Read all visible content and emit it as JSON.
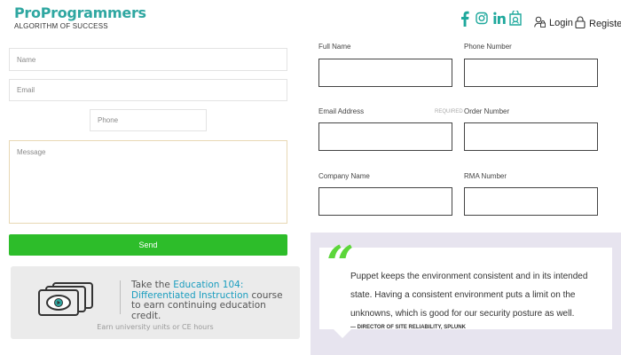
{
  "header": {
    "brand_name": "ProProgrammers",
    "brand_tagline": "ALGORITHM OF SUCCESS",
    "social_icons": [
      "facebook-icon",
      "instagram-icon",
      "linkedin-icon",
      "bag-icon"
    ],
    "login_label": "Login",
    "register_label": "Register",
    "accent_color": "#2fa7a1"
  },
  "left_form": {
    "name_placeholder": "Name",
    "email_placeholder": "Email",
    "phone_placeholder": "Phone",
    "message_placeholder": "Message",
    "send_label": "Send",
    "send_color": "#2dbd2a"
  },
  "promo": {
    "line_pre": "Take the ",
    "course_title": "Education 104: Differentiated Instruction",
    "line_post": " course to earn continuing education credit.",
    "footer": "Earn university units or CE hours"
  },
  "right_form": {
    "full_name_label": "Full Name",
    "phone_number_label": "Phone Number",
    "email_address_label": "Email Address",
    "required_label": "REQUIRED",
    "order_number_label": "Order Number",
    "company_name_label": "Company Name",
    "rma_number_label": "RMA Number"
  },
  "testimonial": {
    "quote": "Puppet keeps the environment consistent and in its intended state. Having a consistent environment puts a limit on the unknowns, which is good for our security posture as well.",
    "attribution": "— DIRECTOR OF SITE RELIABILITY, SPLUNK"
  }
}
